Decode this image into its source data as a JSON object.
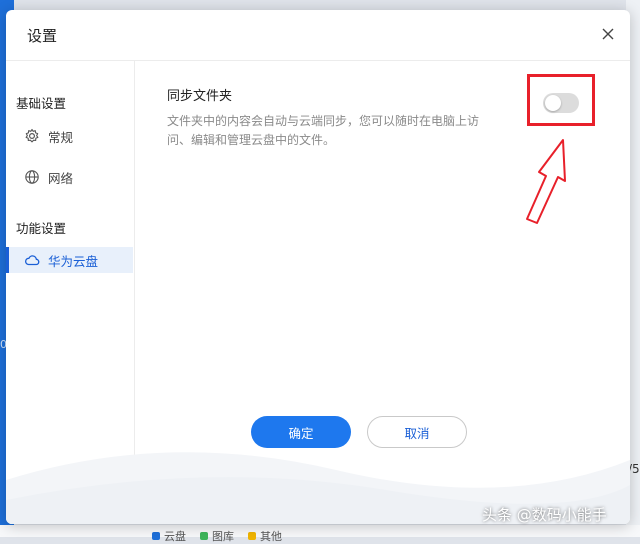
{
  "dialog": {
    "title": "设置"
  },
  "sidebar": {
    "groups": [
      {
        "label": "基础设置",
        "items": [
          {
            "label": "常规",
            "icon": "gear-icon"
          },
          {
            "label": "网络",
            "icon": "globe-icon"
          }
        ]
      },
      {
        "label": "功能设置",
        "items": [
          {
            "label": "华为云盘",
            "icon": "cloud-icon",
            "active": true
          }
        ]
      }
    ]
  },
  "main": {
    "setting_title": "同步文件夹",
    "setting_desc": "文件夹中的内容会自动与云端同步，您可以随时在电脑上访问、编辑和管理云盘中的文件。",
    "sync_enabled": false
  },
  "buttons": {
    "ok": "确定",
    "cancel": "取消"
  },
  "background": {
    "legend": [
      {
        "label": "云盘",
        "color": "#1e6fd9"
      },
      {
        "label": "图库",
        "color": "#3db55a"
      },
      {
        "label": "其他",
        "color": "#f0b400"
      }
    ],
    "left_edge_text": "00",
    "right_edge_text": "/5"
  },
  "watermark": "头条 @数码小能手",
  "colors": {
    "accent": "#1e78ee",
    "annotation": "#e8202a"
  }
}
